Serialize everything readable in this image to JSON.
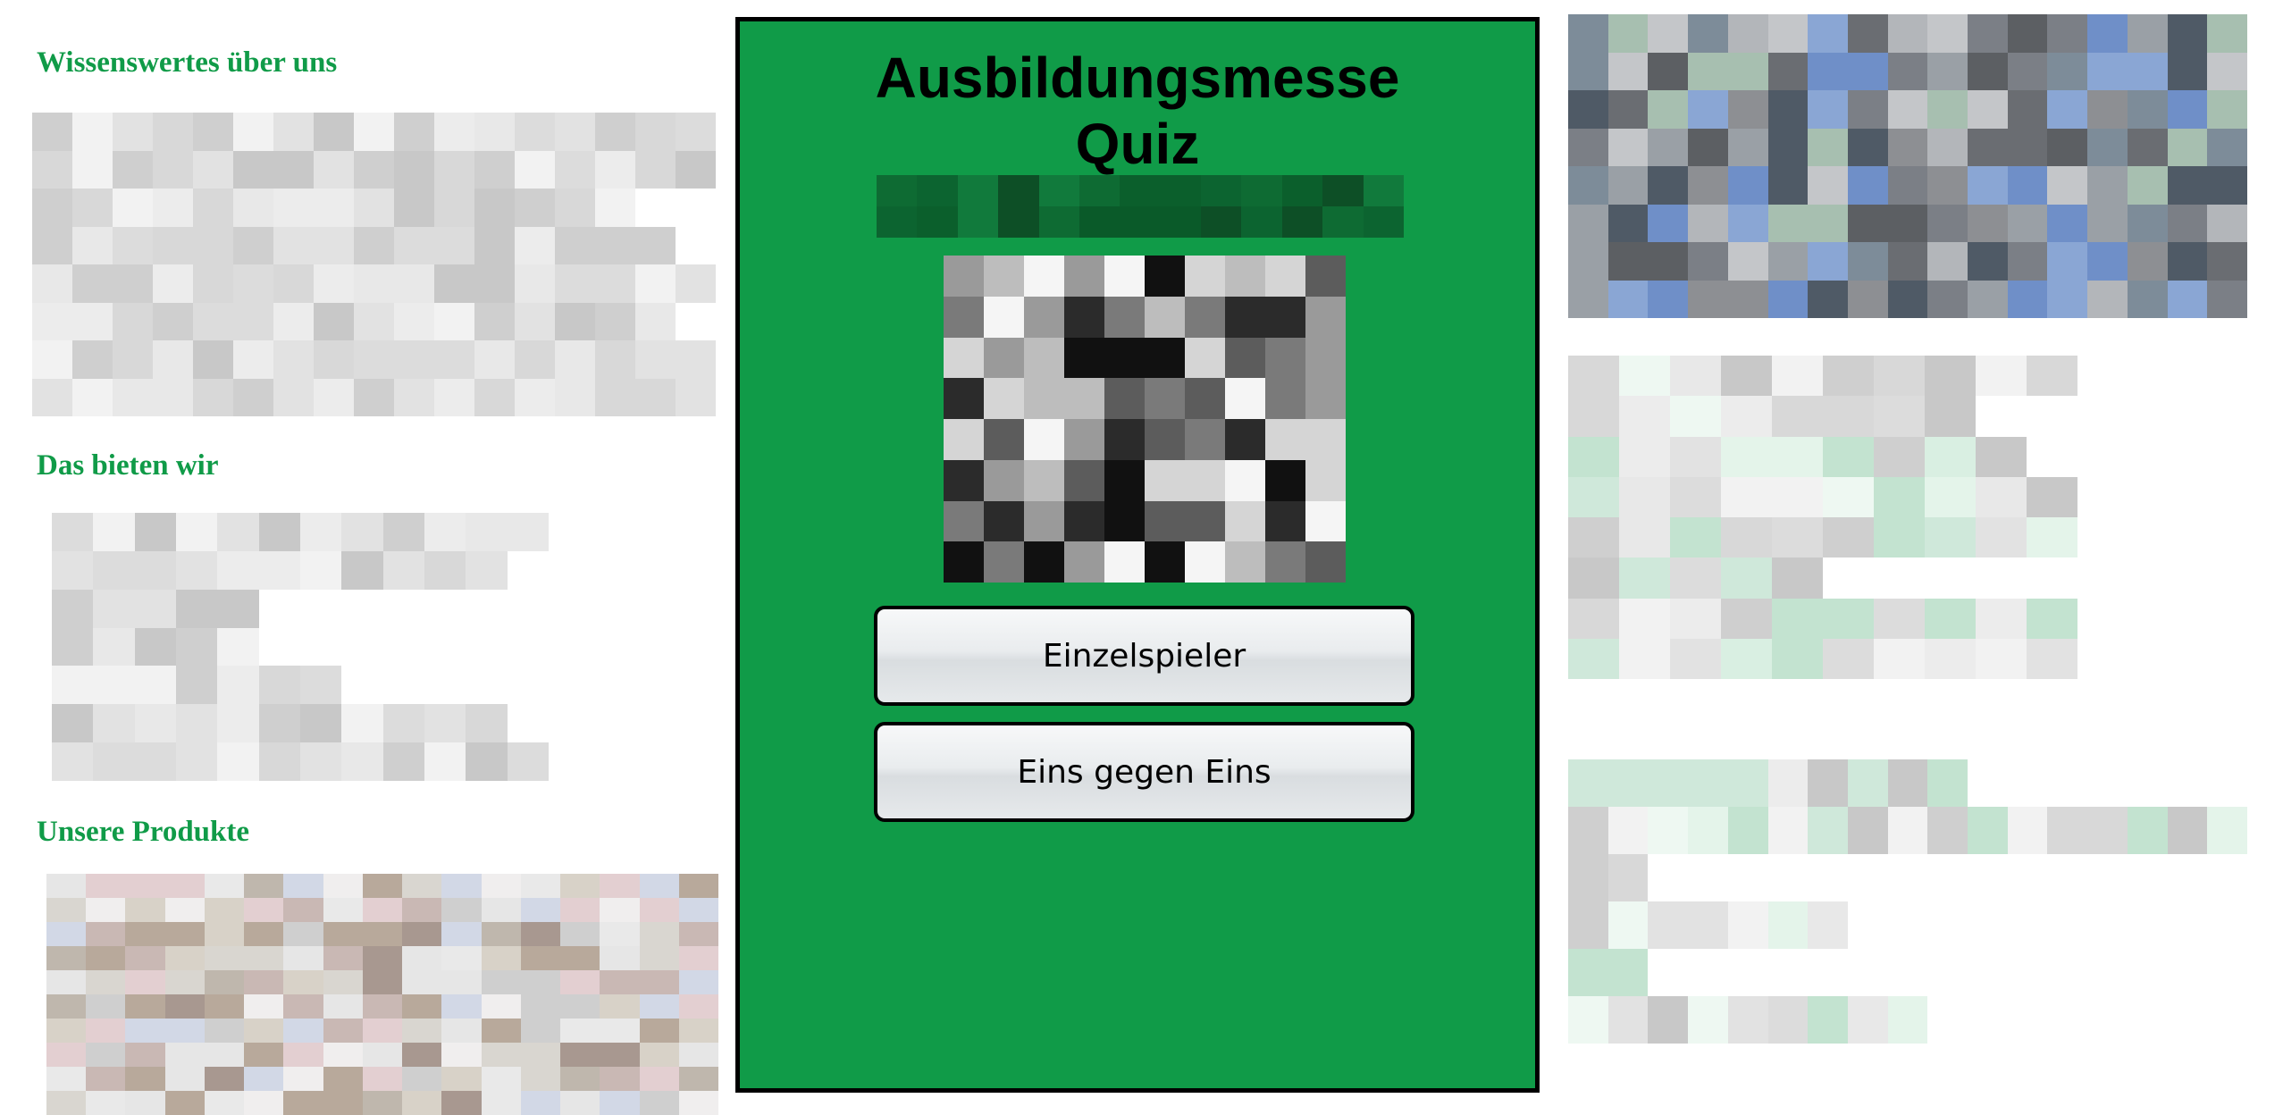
{
  "sections": {
    "about": {
      "heading": "Wissenswertes über uns"
    },
    "offer": {
      "heading": "Das bieten wir"
    },
    "products": {
      "heading": "Unsere Produkte"
    }
  },
  "quiz": {
    "title_line1": "Ausbildungsmesse",
    "title_line2": "Quiz",
    "singleplayer_label": "Einzelspieler",
    "versus_label": "Eins gegen Eins"
  },
  "colors": {
    "brand_green": "#109b48",
    "panel_border": "#000000",
    "heading_green": "#109b48"
  },
  "icons": {
    "logo": "company-logo",
    "photo": "team-photo"
  }
}
